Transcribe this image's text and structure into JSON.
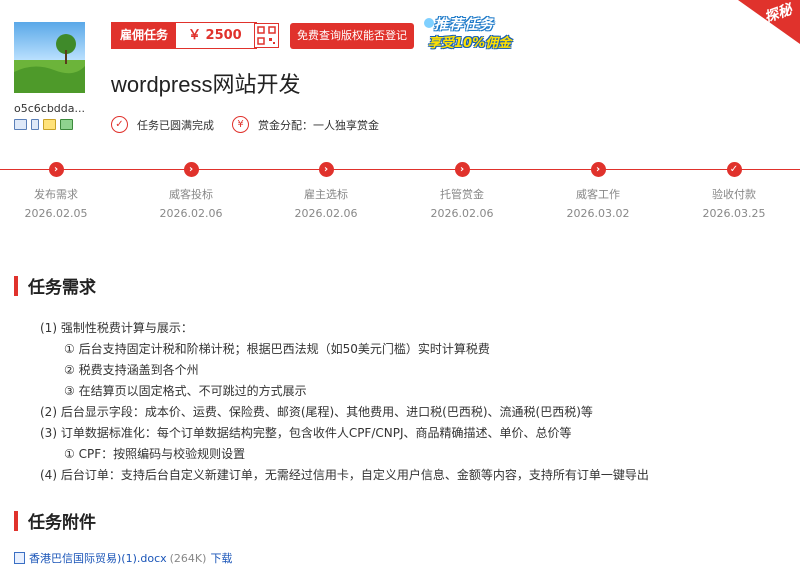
{
  "user": {
    "name": "o5c6cbdda..."
  },
  "task": {
    "type_label": "雇佣任务",
    "price": "￥ 2500",
    "check_button": "免费查询版权能否登记",
    "promo_line1": "推荐任务",
    "promo_line2": "享受10%佣金",
    "corner_badge": "探秘",
    "title": "wordpress网站开发",
    "status_text": "任务已圆满完成",
    "reward_text": "赏金分配：一人独享赏金"
  },
  "progress": [
    {
      "label": "发布需求",
      "date": "2026.02.05",
      "icon": "›"
    },
    {
      "label": "威客投标",
      "date": "2026.02.06",
      "icon": "›"
    },
    {
      "label": "雇主选标",
      "date": "2026.02.06",
      "icon": "›"
    },
    {
      "label": "托管赏金",
      "date": "2026.02.06",
      "icon": "›"
    },
    {
      "label": "威客工作",
      "date": "2026.03.02",
      "icon": "›"
    },
    {
      "label": "验收付款",
      "date": "2026.03.25",
      "icon": "✓"
    }
  ],
  "requirements": {
    "heading": "任务需求",
    "lines": [
      "(1)  强制性税费计算与展示：",
      "①  后台支持固定计税和阶梯计税；根据巴西法规（如50美元门槛）实时计算税费",
      "②  税费支持涵盖到各个州",
      "③  在结算页以固定格式、不可跳过的方式展示",
      "(2)  后台显示字段：成本价、运费、保险费、邮资(尾程)、其他费用、进口税(巴西税)、流通税(巴西税)等",
      "(3)  订单数据标准化：每个订单数据结构完整，包含收件人CPF/CNPJ、商品精确描述、单价、总价等",
      "①  CPF：按照编码与校验规则设置",
      "(4)      后台订单：支持后台自定义新建订单，无需经过信用卡，自定义用户信息、金额等内容，支持所有订单一键导出"
    ]
  },
  "attachments": {
    "heading": "任务附件",
    "file_name": "香港巴信国际贸易)(1).docx",
    "file_size": "(264K)",
    "download": "下载"
  },
  "colors": {
    "accent": "#e0322c",
    "link": "#1a55b8"
  }
}
